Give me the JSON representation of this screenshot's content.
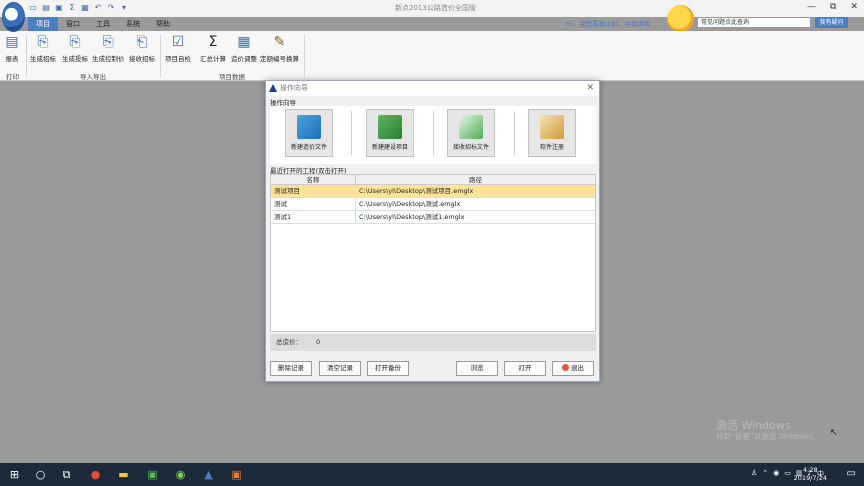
{
  "window": {
    "title": "新点2013公路造价全国版",
    "minimize": "—",
    "maximize": "⧉",
    "close": "✕"
  },
  "menu_tabs": [
    "项目",
    "窗口",
    "工具",
    "系统",
    "帮助"
  ],
  "hint": "Hi，我是看报小秒，点我咨询",
  "search": {
    "value": "常见问题点此查询",
    "button": "我有疑问"
  },
  "ribbon": {
    "tools": [
      "报表",
      "生成招标",
      "生成投标",
      "生成控制价",
      "接收招标",
      "项目自检",
      "汇总计算",
      "造价调整",
      "定额编号换算"
    ],
    "groups": [
      "打印",
      "导入导出",
      "项目数据"
    ]
  },
  "dialog": {
    "title": "操作向导",
    "guide_title": "操作向导",
    "guide_buttons": [
      "新建造价文件",
      "新建建设项目",
      "接收招标文件",
      "软件注册"
    ],
    "recent_title": "最近打开的工程(双击打开)",
    "columns": [
      "名称",
      "路径"
    ],
    "rows": [
      {
        "name": "测试项目",
        "path": "C:\\Users\\yl\\Desktop\\测试项目.emglx"
      },
      {
        "name": "测试",
        "path": "C:\\Users\\yl\\Desktop\\测试.emglx"
      },
      {
        "name": "测试1",
        "path": "C:\\Users\\yl\\Desktop\\测试1.emglx"
      }
    ],
    "total_label": "总造价：",
    "total_value": "0",
    "buttons": {
      "delete": "删除记录",
      "clear": "清空记录",
      "open_backup": "打开备份",
      "browse": "浏览",
      "open": "打开",
      "exit": "退出"
    }
  },
  "watermark": {
    "line1": "激活 Windows",
    "line2": "转到“设置”以激活 Windows。"
  },
  "clock": {
    "time": "4:28",
    "date": "2019/7/24"
  },
  "colors": {
    "accent": "#4a7fc4",
    "selected_row": "#fde39a",
    "taskbar": "#1c2a3a"
  }
}
